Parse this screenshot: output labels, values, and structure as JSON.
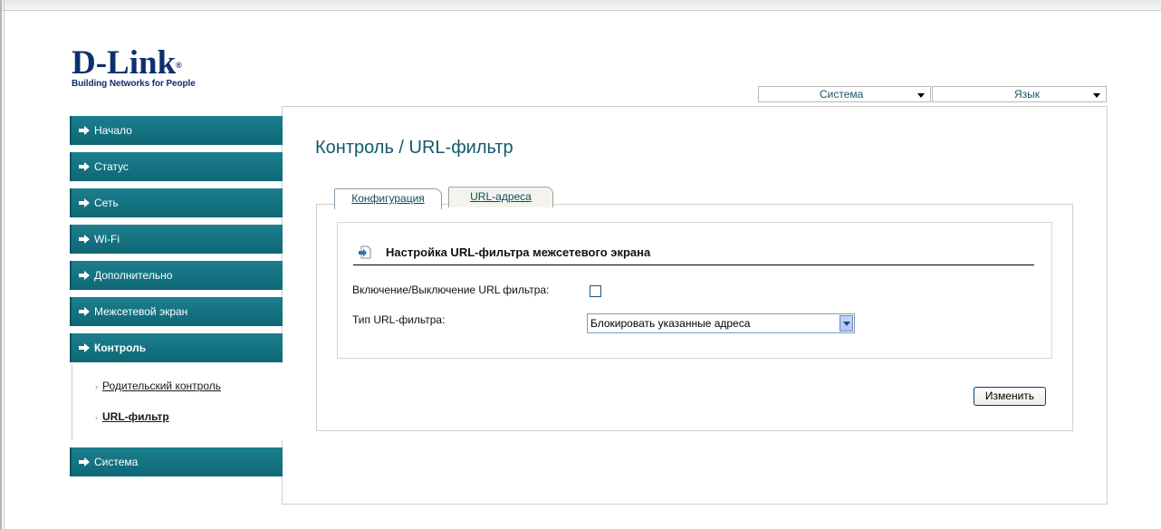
{
  "logo": {
    "main": "D-Link",
    "registered": "®",
    "tagline": "Building Networks for People"
  },
  "top_dropdowns": {
    "system": "Система",
    "language": "Язык"
  },
  "nav": {
    "items": [
      {
        "label": "Начало"
      },
      {
        "label": "Статус"
      },
      {
        "label": "Сеть"
      },
      {
        "label": "Wi-Fi"
      },
      {
        "label": "Дополнительно"
      },
      {
        "label": "Межсетевой экран"
      },
      {
        "label": "Контроль",
        "active": true
      },
      {
        "label": "Система"
      }
    ],
    "subitems": [
      {
        "label": "Родительский контроль"
      },
      {
        "label": "URL-фильтр",
        "active": true
      }
    ],
    "bullet": "›",
    "arrow_icon": "arrow-right-icon"
  },
  "main": {
    "title": "Контроль / URL-фильтр",
    "tabs": [
      {
        "label": "Конфигурация",
        "active": true
      },
      {
        "label": "URL-адреса"
      }
    ],
    "section": {
      "icon": "arrow-into-page-icon",
      "title": "Настройка URL-фильтра межсетевого экрана"
    },
    "fields": {
      "enable_label": "Включение/Выключение URL фильтра:",
      "enable_checked": false,
      "type_label": "Тип URL-фильтра:",
      "type_value": "Блокировать указанные адреса"
    },
    "change_button": "Изменить"
  },
  "colors": {
    "nav_bg": "#137380",
    "title": "#125a6a",
    "logo": "#0e2f6e"
  }
}
